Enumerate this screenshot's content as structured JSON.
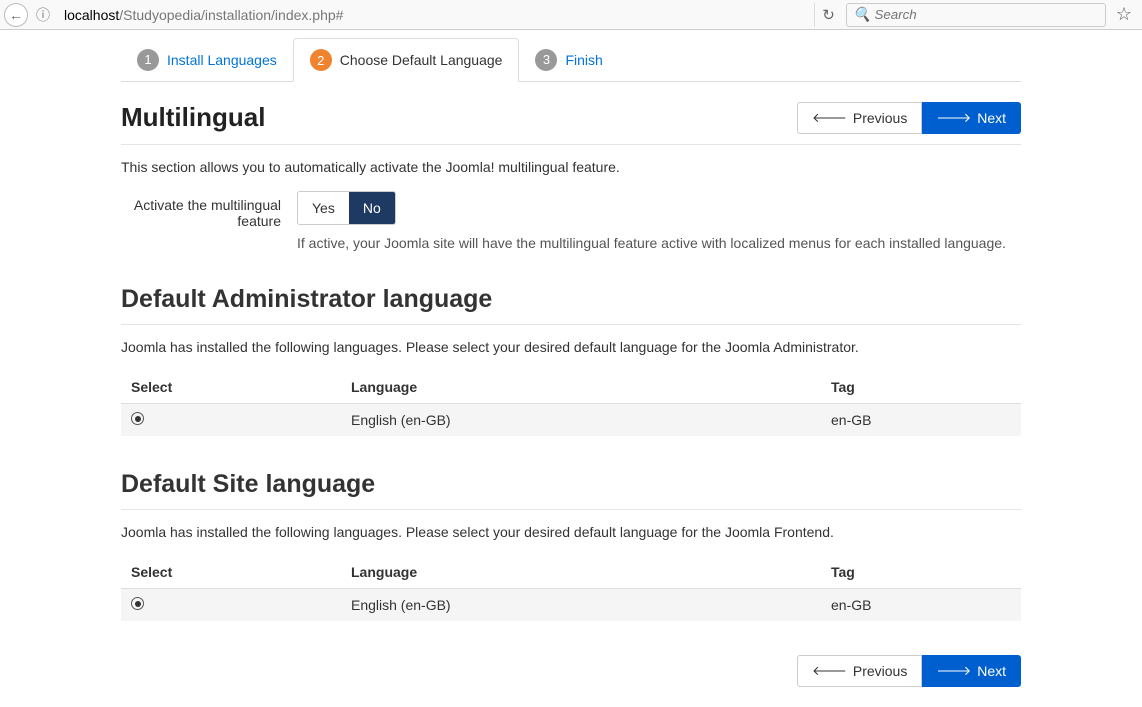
{
  "browser": {
    "url_domain": "localhost",
    "url_rest": "/Studyopedia/installation/index.php#",
    "search_placeholder": "Search"
  },
  "steps": [
    {
      "num": "1",
      "label": "Install Languages",
      "active": false
    },
    {
      "num": "2",
      "label": "Choose Default Language",
      "active": true
    },
    {
      "num": "3",
      "label": "Finish",
      "active": false
    }
  ],
  "buttons": {
    "previous": "Previous",
    "next": "Next"
  },
  "multilingual": {
    "title": "Multilingual",
    "desc": "This section allows you to automatically activate the Joomla! multilingual feature.",
    "toggle_label_1": "Activate the multilingual",
    "toggle_label_2": "feature",
    "yes": "Yes",
    "no": "No",
    "help": "If active, your Joomla site will have the multilingual feature active with localized menus for each installed language."
  },
  "admin_lang": {
    "title": "Default Administrator language",
    "desc": "Joomla has installed the following languages. Please select your desired default language for the Joomla Administrator.",
    "cols": {
      "select": "Select",
      "language": "Language",
      "tag": "Tag"
    },
    "rows": [
      {
        "selected": true,
        "language": "English (en-GB)",
        "tag": "en-GB"
      }
    ]
  },
  "site_lang": {
    "title": "Default Site language",
    "desc": "Joomla has installed the following languages. Please select your desired default language for the Joomla Frontend.",
    "cols": {
      "select": "Select",
      "language": "Language",
      "tag": "Tag"
    },
    "rows": [
      {
        "selected": true,
        "language": "English (en-GB)",
        "tag": "en-GB"
      }
    ]
  }
}
